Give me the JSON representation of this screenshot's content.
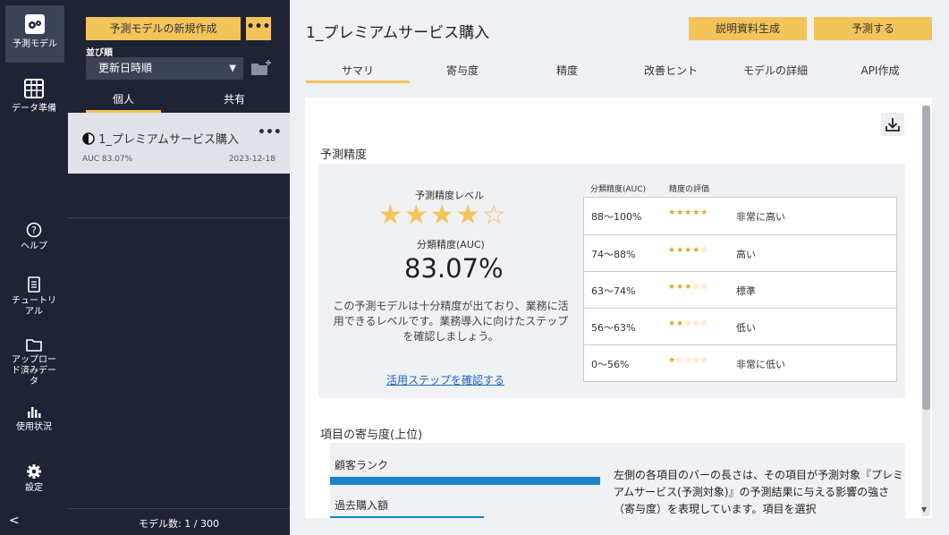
{
  "nav": {
    "predict_label": "予測モデル",
    "data_label": "データ準備",
    "help_label": "ヘルプ",
    "tutorial_label": "チュートリアル",
    "upload_label": "アップロード済みデータ",
    "usage_label": "使用状況",
    "settings_label": "設定",
    "collapse": "<"
  },
  "panel": {
    "new_model": "予測モデルの新規作成",
    "more": "•••",
    "sort_label": "並び順",
    "sort_value": "更新日時順",
    "tab_personal": "個人",
    "tab_shared": "共有",
    "model": {
      "name": "1_プレミアムサービス購入",
      "auc": "AUC 83.07%",
      "date": "2023-12-18",
      "menu": "•••"
    },
    "count": "モデル数: 1 / 300"
  },
  "main": {
    "title": "1_プレミアムサービス購入",
    "explain_btn": "説明資料生成",
    "predict_btn": "予測する",
    "tabs": [
      "サマリ",
      "寄与度",
      "精度",
      "改善ヒント",
      "モデルの詳細",
      "API作成"
    ]
  },
  "accuracy": {
    "section_title": "予測精度",
    "level_label": "予測精度レベル",
    "level_stars": 4,
    "level_stars_total": 5,
    "auc_label": "分類精度(AUC)",
    "auc_value": "83.07%",
    "description": "この予測モデルは十分精度が出ており、業務に活用できるレベルです。業務導入に向けたステップを確認しましょう。",
    "steps_link": "活用ステップを確認する",
    "table_header_auc": "分類精度(AUC)",
    "table_header_eval": "精度の評価",
    "rows": [
      {
        "range": "88～100%",
        "stars": 5,
        "label": "非常に高い"
      },
      {
        "range": "74～88%",
        "stars": 4,
        "label": "高い"
      },
      {
        "range": "63～74%",
        "stars": 3,
        "label": "標準"
      },
      {
        "range": "56～63%",
        "stars": 2,
        "label": "低い"
      },
      {
        "range": "0～56%",
        "stars": 1,
        "label": "非常に低い"
      }
    ]
  },
  "contribution": {
    "section_title": "項目の寄与度(上位)",
    "items": [
      {
        "label": "顧客ランク",
        "share": 1.0
      },
      {
        "label": "過去購入額",
        "share": 0.57
      }
    ],
    "explanation": "左側の各項目のバーの長さは、その項目が予測対象『プレミアムサービス(予測対象)』の予測結果に与える影響の強さ（寄与度）を表現しています。項目を選択"
  },
  "colors": {
    "accent": "#f2c45a",
    "nav_bg": "#1e2436",
    "bar": "#1a84c9",
    "link": "#1a68c7"
  }
}
